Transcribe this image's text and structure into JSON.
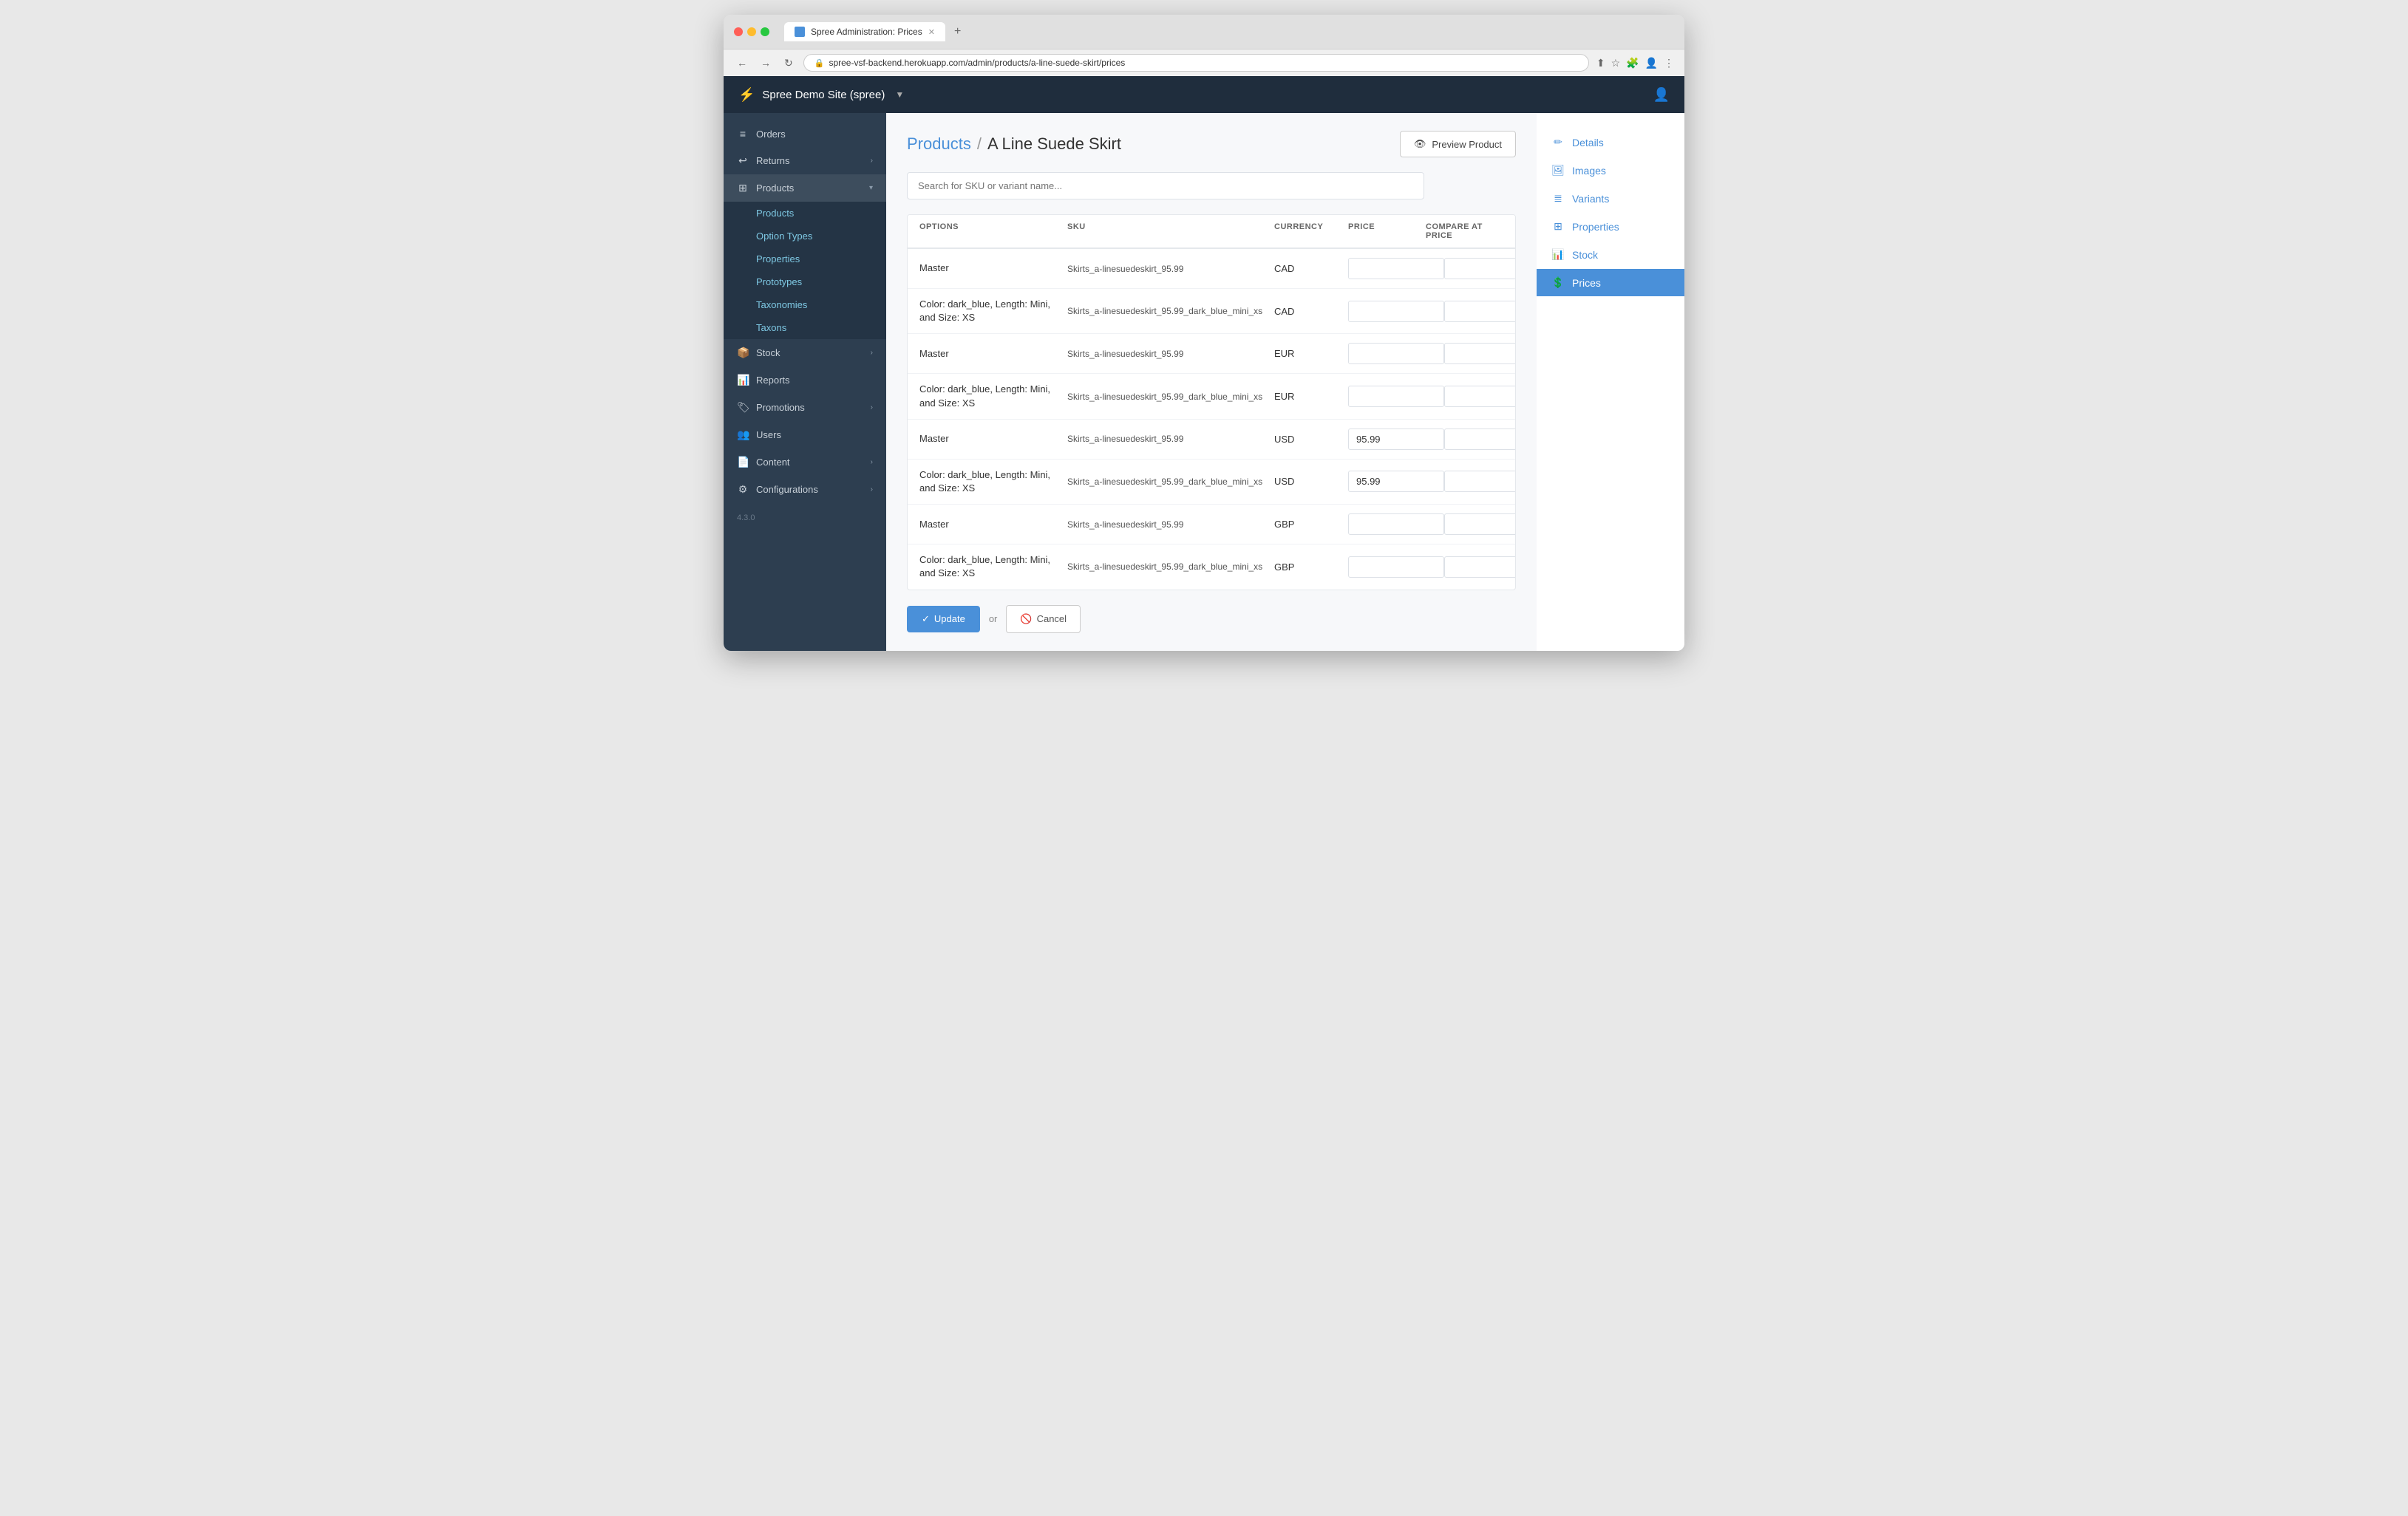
{
  "browser": {
    "tab_title": "Spree Administration: Prices",
    "url": "spree-vsf-backend.herokuapp.com/admin/products/a-line-suede-skirt/prices",
    "new_tab_symbol": "+"
  },
  "topnav": {
    "brand": "Spree Demo Site (spree)",
    "user_icon": "👤"
  },
  "sidebar": {
    "items": [
      {
        "id": "orders",
        "label": "Orders",
        "icon": "≡",
        "has_chevron": false
      },
      {
        "id": "returns",
        "label": "Returns",
        "icon": "↩",
        "has_chevron": true
      },
      {
        "id": "products",
        "label": "Products",
        "icon": "⊞",
        "has_chevron": true,
        "expanded": true
      },
      {
        "id": "stock",
        "label": "Stock",
        "icon": "📦",
        "has_chevron": true
      },
      {
        "id": "reports",
        "label": "Reports",
        "icon": "📊",
        "has_chevron": false
      },
      {
        "id": "promotions",
        "label": "Promotions",
        "icon": "🏷",
        "has_chevron": true
      },
      {
        "id": "users",
        "label": "Users",
        "icon": "👥",
        "has_chevron": false
      },
      {
        "id": "content",
        "label": "Content",
        "icon": "📄",
        "has_chevron": true
      },
      {
        "id": "configurations",
        "label": "Configurations",
        "icon": "⚙",
        "has_chevron": true
      }
    ],
    "products_subitems": [
      {
        "id": "products-list",
        "label": "Products"
      },
      {
        "id": "option-types",
        "label": "Option Types"
      },
      {
        "id": "properties",
        "label": "Properties"
      },
      {
        "id": "prototypes",
        "label": "Prototypes"
      },
      {
        "id": "taxonomies",
        "label": "Taxonomies"
      },
      {
        "id": "taxons",
        "label": "Taxons"
      }
    ],
    "version": "4.3.0"
  },
  "page": {
    "breadcrumb_link": "Products",
    "breadcrumb_separator": "/",
    "breadcrumb_current": "A Line Suede Skirt",
    "preview_button": "Preview Product",
    "search_placeholder": "Search for SKU or variant name..."
  },
  "table": {
    "columns": [
      "OPTIONS",
      "SKU",
      "CURRENCY",
      "PRICE",
      "COMPARE AT PRICE"
    ],
    "rows": [
      {
        "options": "Master",
        "sku": "Skirts_a-linesuedeskirt_95.99",
        "currency": "CAD",
        "price": "",
        "compare_at": ""
      },
      {
        "options": "Color: dark_blue, Length: Mini, and Size: XS",
        "sku": "Skirts_a-linesuedeskirt_95.99_dark_blue_mini_xs",
        "currency": "CAD",
        "price": "",
        "compare_at": ""
      },
      {
        "options": "Master",
        "sku": "Skirts_a-linesuedeskirt_95.99",
        "currency": "EUR",
        "price": "",
        "compare_at": ""
      },
      {
        "options": "Color: dark_blue, Length: Mini, and Size: XS",
        "sku": "Skirts_a-linesuedeskirt_95.99_dark_blue_mini_xs",
        "currency": "EUR",
        "price": "",
        "compare_at": ""
      },
      {
        "options": "Master",
        "sku": "Skirts_a-linesuedeskirt_95.99",
        "currency": "USD",
        "price": "95.99",
        "compare_at": ""
      },
      {
        "options": "Color: dark_blue, Length: Mini, and Size: XS",
        "sku": "Skirts_a-linesuedeskirt_95.99_dark_blue_mini_xs",
        "currency": "USD",
        "price": "95.99",
        "compare_at": ""
      },
      {
        "options": "Master",
        "sku": "Skirts_a-linesuedeskirt_95.99",
        "currency": "GBP",
        "price": "",
        "compare_at": ""
      },
      {
        "options": "Color: dark_blue, Length: Mini, and Size: XS",
        "sku": "Skirts_a-linesuedeskirt_95.99_dark_blue_mini_xs",
        "currency": "GBP",
        "price": "",
        "compare_at": ""
      }
    ]
  },
  "actions": {
    "update_label": "Update",
    "or_label": "or",
    "cancel_label": "Cancel"
  },
  "right_sidebar": {
    "items": [
      {
        "id": "details",
        "label": "Details",
        "icon": "✏"
      },
      {
        "id": "images",
        "label": "Images",
        "icon": "🖼"
      },
      {
        "id": "variants",
        "label": "Variants",
        "icon": "≣"
      },
      {
        "id": "properties",
        "label": "Properties",
        "icon": "⊞"
      },
      {
        "id": "stock",
        "label": "Stock",
        "icon": "📊"
      },
      {
        "id": "prices",
        "label": "Prices",
        "icon": "💲",
        "active": true
      }
    ]
  }
}
